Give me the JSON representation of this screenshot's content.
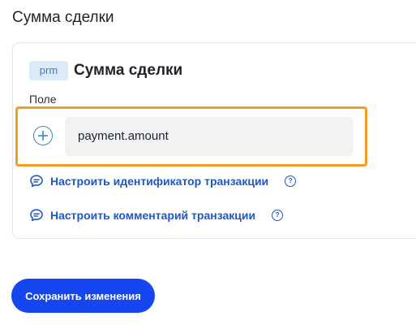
{
  "page": {
    "section_title": "Сумма сделки"
  },
  "card": {
    "badge": "prm",
    "title": "Сумма сделки",
    "field_label": "Поле",
    "field_value": "payment.amount",
    "links": [
      {
        "label": "Настроить идентификатор транзакции",
        "icon": "chat-icon",
        "help_icon": "question-icon"
      },
      {
        "label": "Настроить комментарий транзакции",
        "icon": "chat-icon",
        "help_icon": "question-icon"
      }
    ],
    "help_glyph": "?"
  },
  "footer": {
    "save_label": "Сохранить изменения"
  },
  "colors": {
    "accent": "#1546f0",
    "link": "#1d58c7",
    "highlight": "#f59a23",
    "badge_bg": "#dbe9f8"
  }
}
